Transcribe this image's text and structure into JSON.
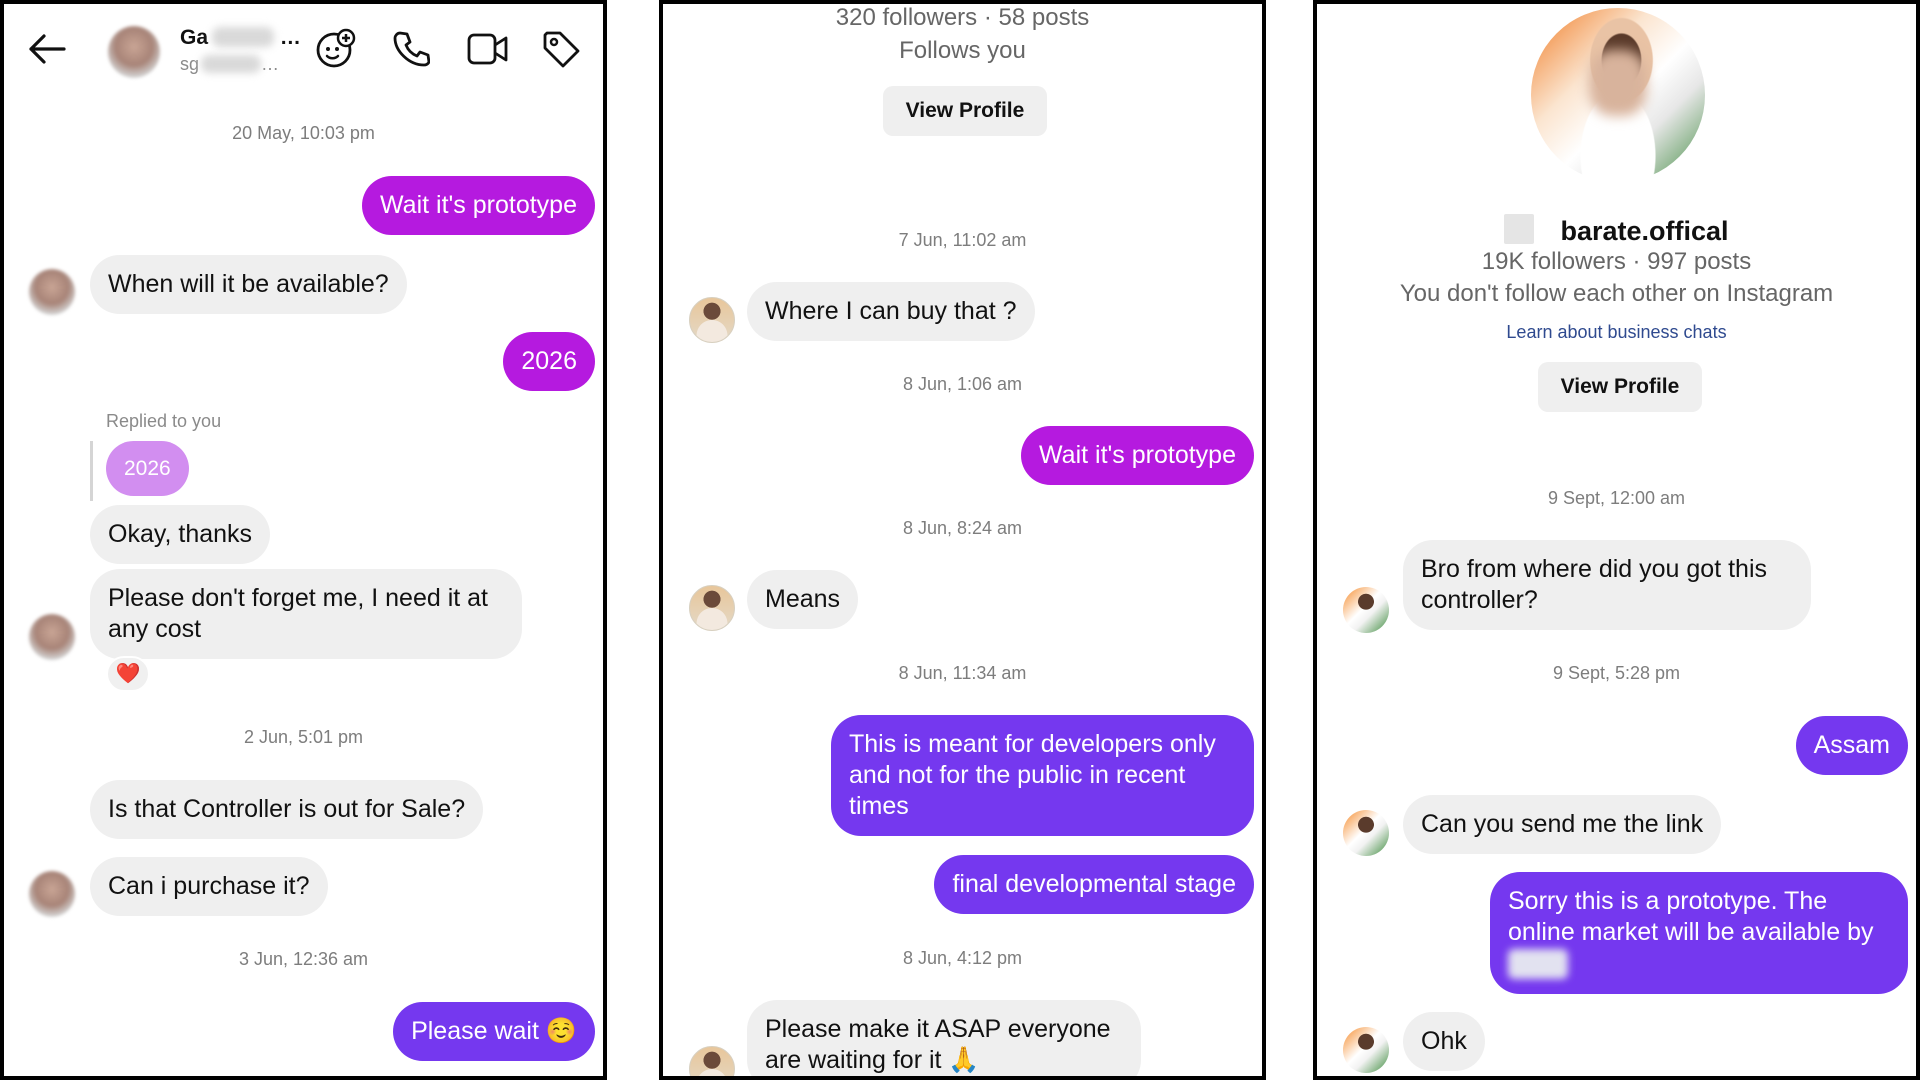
{
  "panel1": {
    "header": {
      "name": "Ga",
      "username": "sg"
    },
    "messages": {
      "ts1": "20 May, 10:03 pm",
      "out1": "Wait it's prototype",
      "in1": "When will it be available?",
      "out2": "2026",
      "replied_label": "Replied to you",
      "replied_quote": "2026",
      "in2": "Okay, thanks",
      "in3": "Please don't forget me, I need it at any cost",
      "reaction": "❤️",
      "ts2": "2 Jun, 5:01 pm",
      "in4": "Is that Controller is out for Sale?",
      "in5": "Can i purchase it?",
      "ts3": "3 Jun, 12:36 am",
      "out3": "Please wait ☺️"
    }
  },
  "panel2": {
    "profile": {
      "stats": "320 followers · 58 posts",
      "relation": "Follows you",
      "view_profile": "View Profile"
    },
    "messages": {
      "ts1": "7 Jun, 11:02 am",
      "in1": "Where I can buy that ?",
      "ts2": "8 Jun, 1:06 am",
      "out1": "Wait it's prototype",
      "ts3": "8 Jun, 8:24 am",
      "in2": "Means",
      "ts4": "8 Jun, 11:34 am",
      "out2": "This is meant for developers only and not for the public in recent times",
      "out3": "final developmental stage",
      "ts5": "8 Jun, 4:12 pm",
      "in3": "Please make it ASAP everyone are waiting for it 🙏"
    }
  },
  "panel3": {
    "profile": {
      "name": "barate.offical",
      "stats": "19K followers · 997 posts",
      "relation": "You don't follow each other on Instagram",
      "learn_link": "Learn about business chats",
      "view_profile": "View Profile"
    },
    "messages": {
      "ts1": "9 Sept, 12:00 am",
      "in1": "Bro from where did you got this controller?",
      "ts2": "9 Sept, 5:28 pm",
      "out1": "Assam",
      "in2": "Can you send me the link",
      "out2": "Sorry this is a prototype. The online market will be available by",
      "in3": "Ohk"
    }
  },
  "colors": {
    "outgoing_magenta": "#b51adf",
    "outgoing_purple": "#7538ef",
    "incoming": "#efefef",
    "timestamp": "#7d7d7d",
    "link": "#2f4a8f"
  },
  "icons": [
    "back-arrow-icon",
    "sticker-add-icon",
    "phone-icon",
    "video-icon",
    "tag-icon"
  ]
}
